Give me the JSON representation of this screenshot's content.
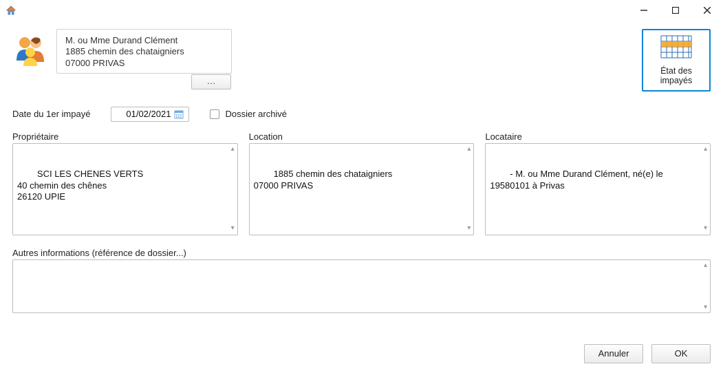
{
  "window": {
    "minimize": "−",
    "maximize": "☐",
    "close": "✕"
  },
  "header": {
    "address_line1": "M. ou Mme Durand Clément",
    "address_line2": "1885 chemin des chataigniers",
    "address_line3": "07000 PRIVAS",
    "more_label": "…"
  },
  "etat": {
    "line1": "État des",
    "line2": "impayés"
  },
  "date": {
    "label": "Date du 1er impayé",
    "value": "01/02/2021"
  },
  "archive": {
    "label": "Dossier archivé",
    "checked": false
  },
  "proprietaire": {
    "label": "Propriétaire",
    "text": "SCI LES CHENES VERTS\n40 chemin des chênes\n26120 UPIE"
  },
  "location": {
    "label": "Location",
    "text": "1885 chemin des chataigniers\n07000 PRIVAS"
  },
  "locataire": {
    "label": "Locataire",
    "text": "- M. ou Mme Durand Clément, né(e) le 19580101 à Privas"
  },
  "other": {
    "label": "Autres informations (référence de dossier...)",
    "text": ""
  },
  "buttons": {
    "cancel": "Annuler",
    "ok": "OK"
  }
}
